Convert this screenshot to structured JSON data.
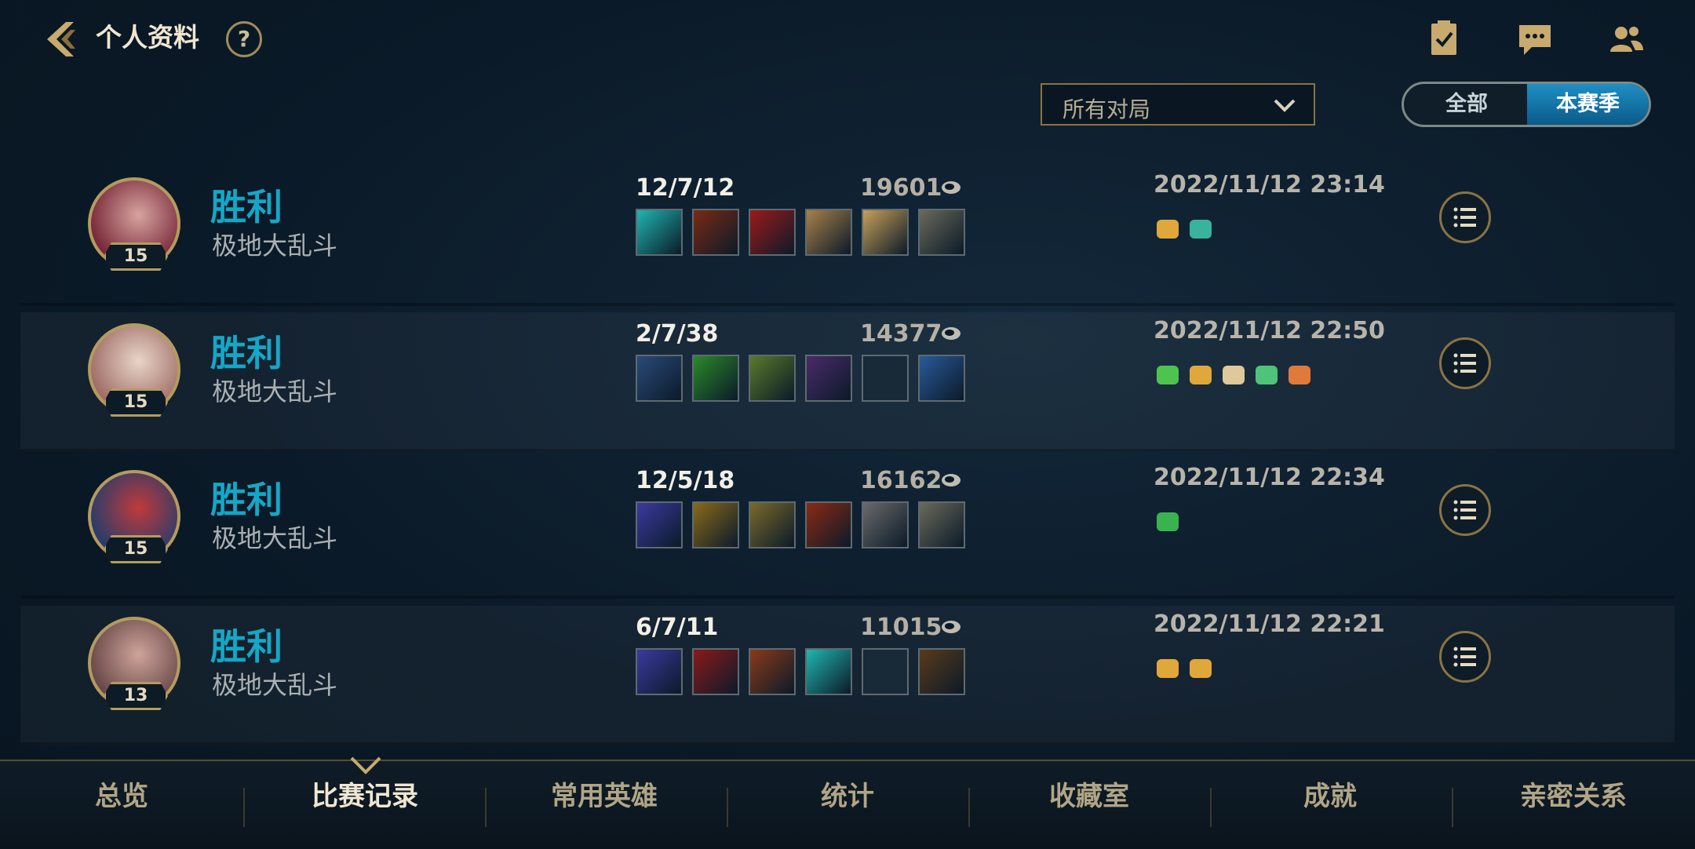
{
  "header": {
    "title": "个人资料",
    "help_label": "?",
    "icons": [
      "back-chevron-icon",
      "clipboard-check-icon",
      "chat-icon",
      "friends-icon"
    ]
  },
  "filters": {
    "dropdown_value": "所有对局",
    "toggle_all": "全部",
    "toggle_season": "本赛季"
  },
  "matches": [
    {
      "level": "15",
      "result": "胜利",
      "mode": "极地大乱斗",
      "kda": "12/7/12",
      "gold": "19601",
      "date": "2022/11/12 23:14",
      "items": 6,
      "empty_slots": []
    },
    {
      "level": "15",
      "result": "胜利",
      "mode": "极地大乱斗",
      "kda": "2/7/38",
      "gold": "14377",
      "date": "2022/11/12 22:50",
      "items": 6,
      "empty_slots": [
        4
      ]
    },
    {
      "level": "15",
      "result": "胜利",
      "mode": "极地大乱斗",
      "kda": "12/5/18",
      "gold": "16162",
      "date": "2022/11/12 22:34",
      "items": 6,
      "empty_slots": []
    },
    {
      "level": "13",
      "result": "胜利",
      "mode": "极地大乱斗",
      "kda": "6/7/11",
      "gold": "11015",
      "date": "2022/11/12 22:21",
      "items": 6,
      "empty_slots": [
        4
      ]
    }
  ],
  "nav": {
    "items": [
      "总览",
      "比赛记录",
      "常用英雄",
      "统计",
      "收藏室",
      "成就",
      "亲密关系"
    ],
    "active": "比赛记录"
  },
  "colors": {
    "accent_gold": "#b49b5e",
    "win_blue": "#14a7c7",
    "toggle_active": "#1f8fc4"
  }
}
